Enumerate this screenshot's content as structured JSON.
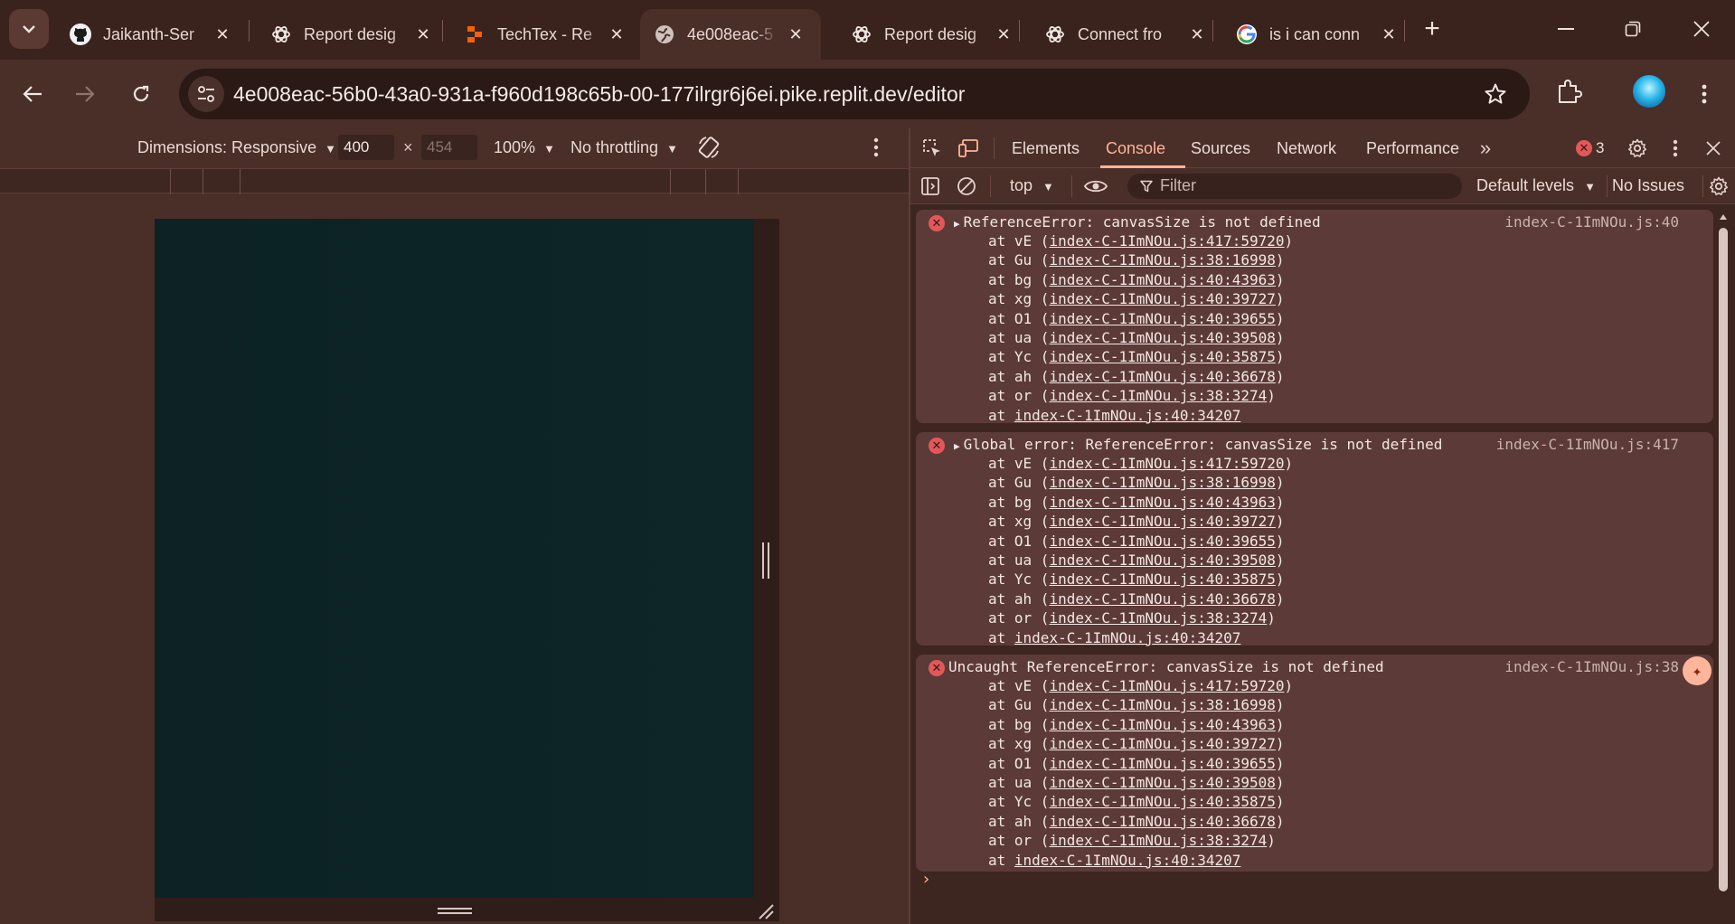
{
  "tabs": [
    {
      "title": "Jaikanth-Ser",
      "icon": "github-icon"
    },
    {
      "title": "Report desig",
      "icon": "openai-icon"
    },
    {
      "title": "TechTex - Re",
      "icon": "replit-icon"
    },
    {
      "title": "4e008eac-5",
      "icon": "globe-icon",
      "active": true
    },
    {
      "title": "Report desig",
      "icon": "openai-icon"
    },
    {
      "title": "Connect fro",
      "icon": "openai-icon"
    },
    {
      "title": "is i can conn",
      "icon": "google-icon"
    }
  ],
  "address_bar": {
    "url": "4e008eac-56b0-43a0-931a-f960d198c65b-00-177ilrgr6j6ei.pike.replit.dev/editor"
  },
  "device_toolbar": {
    "dimensions_label": "Dimensions: Responsive",
    "width": "400",
    "times": "×",
    "height": "454",
    "zoom": "100%",
    "throttling": "No throttling"
  },
  "devtools": {
    "tabs": [
      "Elements",
      "Console",
      "Sources",
      "Network",
      "Performance"
    ],
    "active_tab": "Console",
    "error_count": "3",
    "console_toolbar": {
      "context": "top",
      "filter_placeholder": "Filter",
      "levels": "Default levels",
      "issues": "No Issues"
    },
    "messages": [
      {
        "text": "ReferenceError: canvasSize is not defined",
        "source": "index-C-1ImNOu.js:40",
        "expandable": true,
        "stack": [
          {
            "prefix": "at vE (",
            "link": "index-C-1ImNOu.js:417:59720",
            "suffix": ")"
          },
          {
            "prefix": "at Gu (",
            "link": "index-C-1ImNOu.js:38:16998",
            "suffix": ")"
          },
          {
            "prefix": "at bg (",
            "link": "index-C-1ImNOu.js:40:43963",
            "suffix": ")"
          },
          {
            "prefix": "at xg (",
            "link": "index-C-1ImNOu.js:40:39727",
            "suffix": ")"
          },
          {
            "prefix": "at O1 (",
            "link": "index-C-1ImNOu.js:40:39655",
            "suffix": ")"
          },
          {
            "prefix": "at ua (",
            "link": "index-C-1ImNOu.js:40:39508",
            "suffix": ")"
          },
          {
            "prefix": "at Yc (",
            "link": "index-C-1ImNOu.js:40:35875",
            "suffix": ")"
          },
          {
            "prefix": "at ah (",
            "link": "index-C-1ImNOu.js:40:36678",
            "suffix": ")"
          },
          {
            "prefix": "at or (",
            "link": "index-C-1ImNOu.js:38:3274",
            "suffix": ")"
          },
          {
            "prefix": "at ",
            "link": "index-C-1ImNOu.js:40:34207",
            "suffix": ""
          }
        ]
      },
      {
        "text": "Global error: ReferenceError: canvasSize is not defined",
        "source": "index-C-1ImNOu.js:417",
        "expandable": true,
        "stack": [
          {
            "prefix": "at vE (",
            "link": "index-C-1ImNOu.js:417:59720",
            "suffix": ")"
          },
          {
            "prefix": "at Gu (",
            "link": "index-C-1ImNOu.js:38:16998",
            "suffix": ")"
          },
          {
            "prefix": "at bg (",
            "link": "index-C-1ImNOu.js:40:43963",
            "suffix": ")"
          },
          {
            "prefix": "at xg (",
            "link": "index-C-1ImNOu.js:40:39727",
            "suffix": ")"
          },
          {
            "prefix": "at O1 (",
            "link": "index-C-1ImNOu.js:40:39655",
            "suffix": ")"
          },
          {
            "prefix": "at ua (",
            "link": "index-C-1ImNOu.js:40:39508",
            "suffix": ")"
          },
          {
            "prefix": "at Yc (",
            "link": "index-C-1ImNOu.js:40:35875",
            "suffix": ")"
          },
          {
            "prefix": "at ah (",
            "link": "index-C-1ImNOu.js:40:36678",
            "suffix": ")"
          },
          {
            "prefix": "at or (",
            "link": "index-C-1ImNOu.js:38:3274",
            "suffix": ")"
          },
          {
            "prefix": "at ",
            "link": "index-C-1ImNOu.js:40:34207",
            "suffix": ""
          }
        ]
      },
      {
        "text": "Uncaught ReferenceError: canvasSize is not defined",
        "source": "index-C-1ImNOu.js:38",
        "expandable": false,
        "stack": [
          {
            "prefix": "at vE (",
            "link": "index-C-1ImNOu.js:417:59720",
            "suffix": ")"
          },
          {
            "prefix": "at Gu (",
            "link": "index-C-1ImNOu.js:38:16998",
            "suffix": ")"
          },
          {
            "prefix": "at bg (",
            "link": "index-C-1ImNOu.js:40:43963",
            "suffix": ")"
          },
          {
            "prefix": "at xg (",
            "link": "index-C-1ImNOu.js:40:39727",
            "suffix": ")"
          },
          {
            "prefix": "at O1 (",
            "link": "index-C-1ImNOu.js:40:39655",
            "suffix": ")"
          },
          {
            "prefix": "at ua (",
            "link": "index-C-1ImNOu.js:40:39508",
            "suffix": ")"
          },
          {
            "prefix": "at Yc (",
            "link": "index-C-1ImNOu.js:40:35875",
            "suffix": ")"
          },
          {
            "prefix": "at ah (",
            "link": "index-C-1ImNOu.js:40:36678",
            "suffix": ")"
          },
          {
            "prefix": "at or (",
            "link": "index-C-1ImNOu.js:38:3274",
            "suffix": ")"
          },
          {
            "prefix": "at ",
            "link": "index-C-1ImNOu.js:40:34207",
            "suffix": ""
          }
        ]
      }
    ],
    "prompt": "›"
  },
  "colors": {
    "chrome_bg": "#4a2e28",
    "tabstrip_bg": "#3a221d",
    "accent": "#ffb59a",
    "error_red": "#e2585a",
    "viewport_bg": "#0c2224"
  }
}
